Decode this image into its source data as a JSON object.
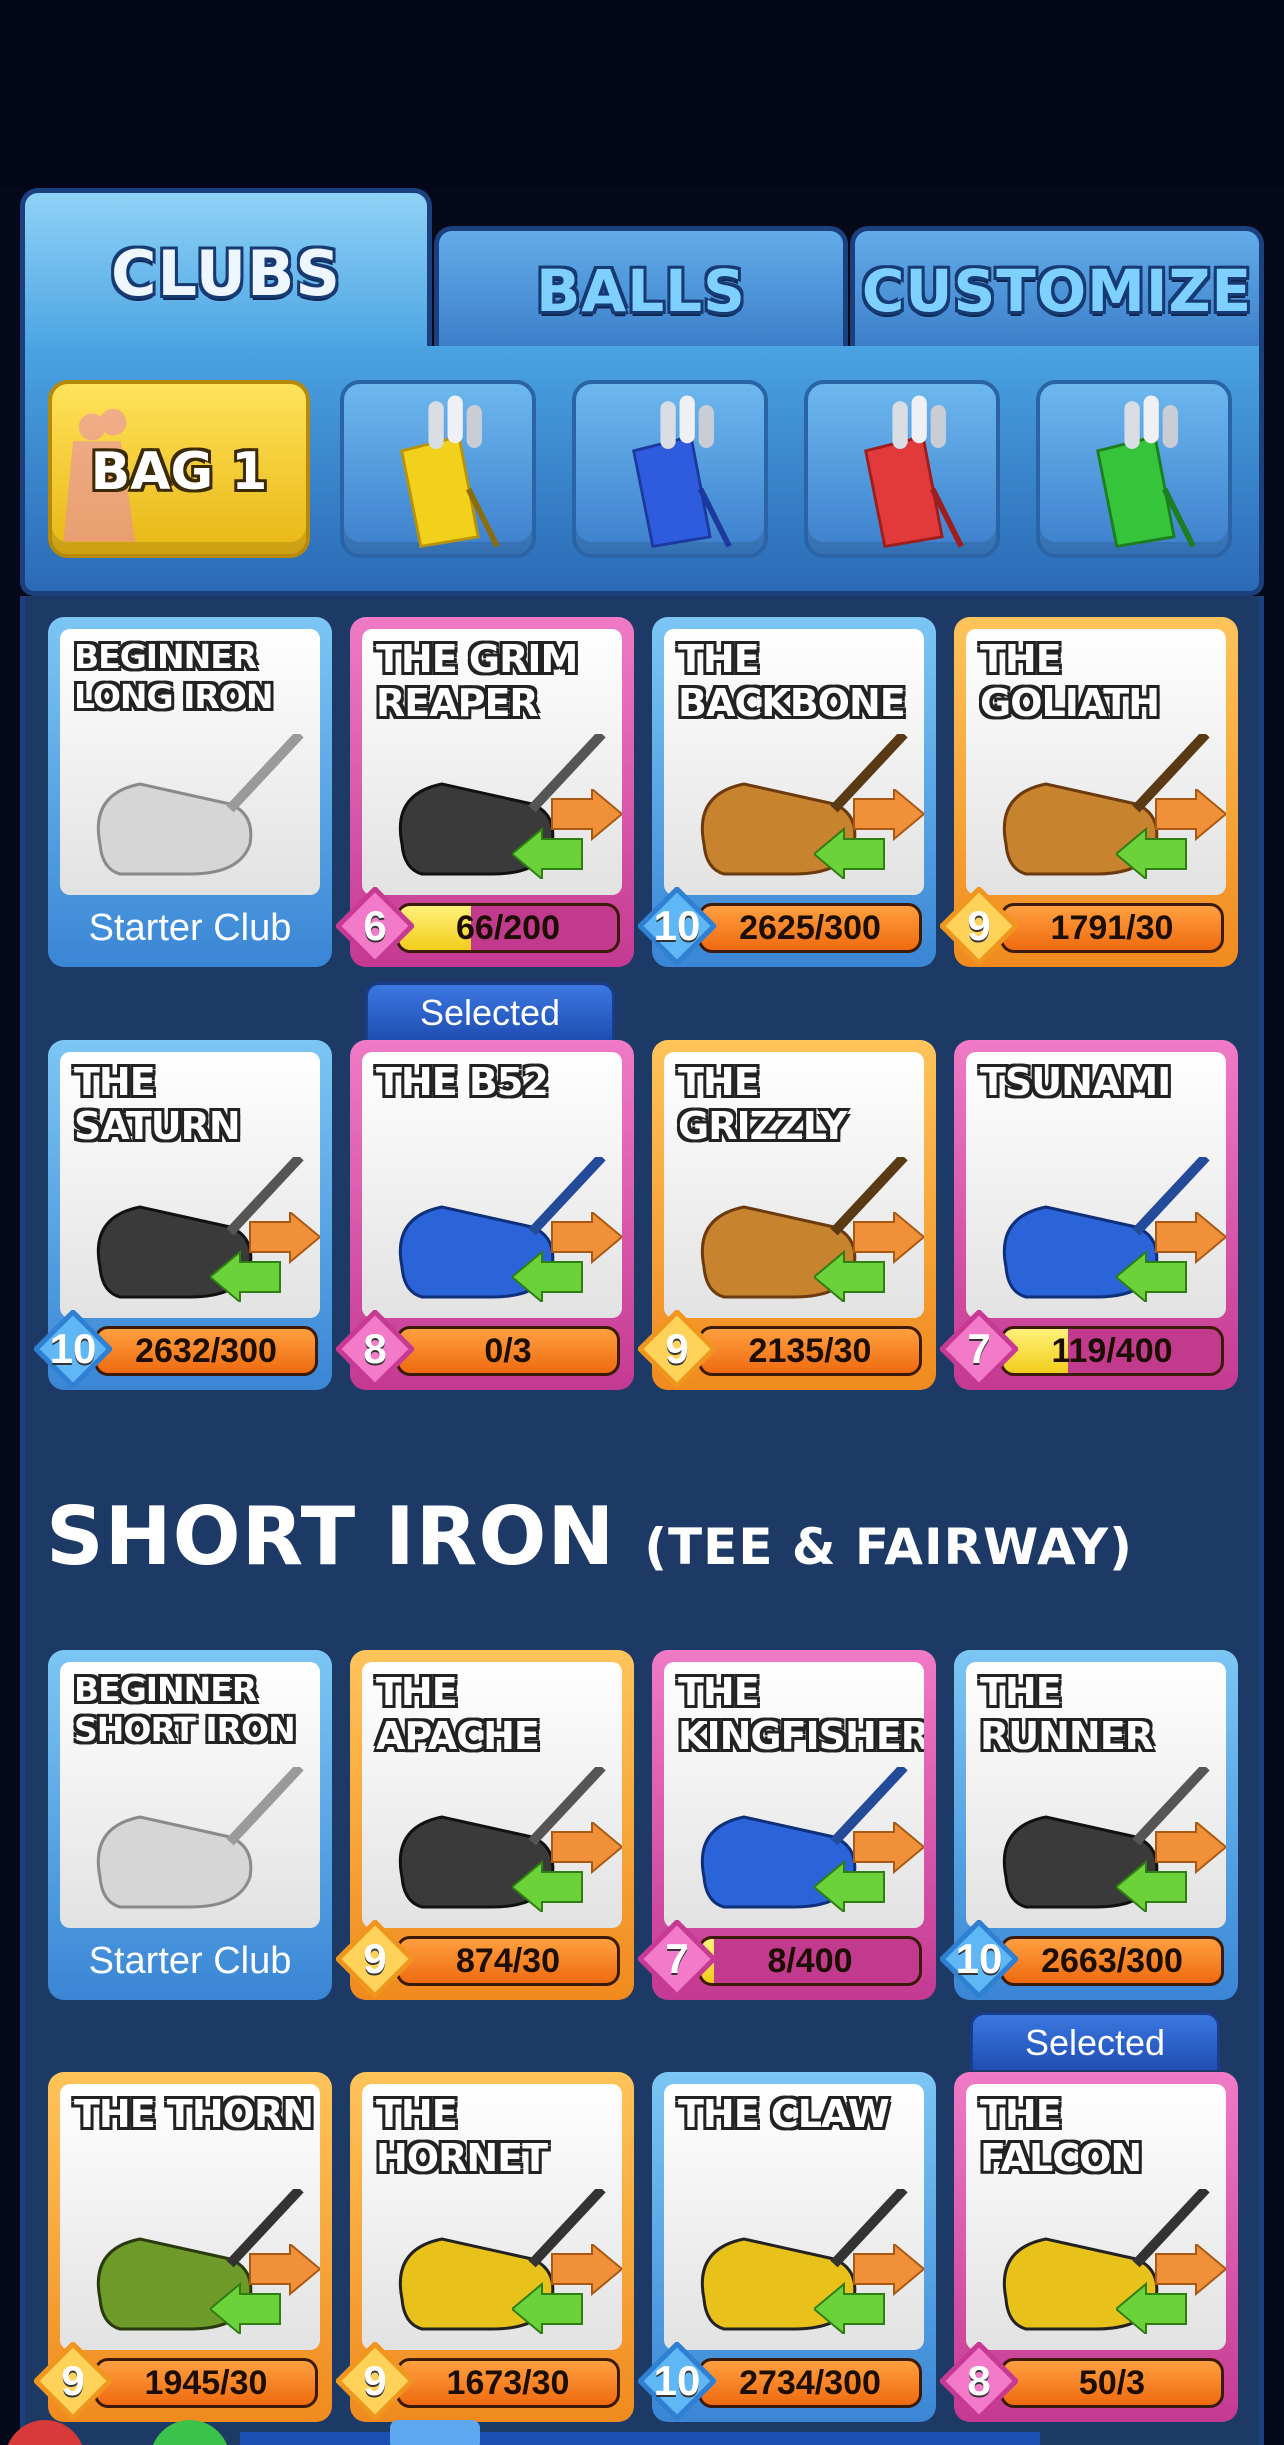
{
  "tabs": [
    {
      "label": "CLUBS",
      "active": true
    },
    {
      "label": "BALLS",
      "active": false
    },
    {
      "label": "CUSTOMIZE",
      "active": false
    }
  ],
  "bags": [
    {
      "label": "BAG 1",
      "color": "#f2c21c",
      "active": true
    },
    {
      "label": "",
      "color": "#f2d11c",
      "active": false
    },
    {
      "label": "",
      "color": "#2f5bde",
      "active": false
    },
    {
      "label": "",
      "color": "#e23a3a",
      "active": false
    },
    {
      "label": "",
      "color": "#35c43a",
      "active": false
    }
  ],
  "section_title": {
    "main": "SHORT IRON",
    "sub": "(TEE & FAIRWAY)"
  },
  "selected_label": "Selected",
  "long_iron_cards": [
    {
      "name": "BEGINNER LONG IRON",
      "rarity": "blue",
      "starter": "Starter Club",
      "level": null,
      "progress": null
    },
    {
      "name": "THE GRIM REAPER",
      "rarity": "pink",
      "level": "6",
      "progress": "66/200",
      "fill": 0.33
    },
    {
      "name": "THE BACKBONE",
      "rarity": "blue",
      "level": "10",
      "progress": "2625/300",
      "fill": 1
    },
    {
      "name": "THE GOLIATH",
      "rarity": "orange",
      "level": "9",
      "progress": "1791/30",
      "fill": 1
    },
    {
      "name": "THE SATURN",
      "rarity": "blue",
      "level": "10",
      "progress": "2632/300",
      "fill": 1
    },
    {
      "name": "THE B52",
      "rarity": "pink",
      "level": "8",
      "progress": "0/3",
      "fill": 1,
      "selected": true
    },
    {
      "name": "THE GRIZZLY",
      "rarity": "orange",
      "level": "9",
      "progress": "2135/30",
      "fill": 1
    },
    {
      "name": "TSUNAMI",
      "rarity": "pink",
      "level": "7",
      "progress": "119/400",
      "fill": 0.3
    }
  ],
  "short_iron_cards": [
    {
      "name": "BEGINNER SHORT IRON",
      "rarity": "blue",
      "starter": "Starter Club",
      "level": null,
      "progress": null
    },
    {
      "name": "THE APACHE",
      "rarity": "orange",
      "level": "9",
      "progress": "874/30",
      "fill": 1
    },
    {
      "name": "THE KINGFISHER",
      "rarity": "pink",
      "level": "7",
      "progress": "8/400",
      "fill": 0.02
    },
    {
      "name": "THE RUNNER",
      "rarity": "blue",
      "level": "10",
      "progress": "2663/300",
      "fill": 1
    },
    {
      "name": "THE THORN",
      "rarity": "orange",
      "level": "9",
      "progress": "1945/30",
      "fill": 1
    },
    {
      "name": "THE HORNET",
      "rarity": "orange",
      "level": "9",
      "progress": "1673/30",
      "fill": 1
    },
    {
      "name": "THE CLAW",
      "rarity": "blue",
      "level": "10",
      "progress": "2734/300",
      "fill": 1
    },
    {
      "name": "THE FALCON",
      "rarity": "pink",
      "level": "8",
      "progress": "50/3",
      "fill": 1,
      "selected": true
    }
  ]
}
